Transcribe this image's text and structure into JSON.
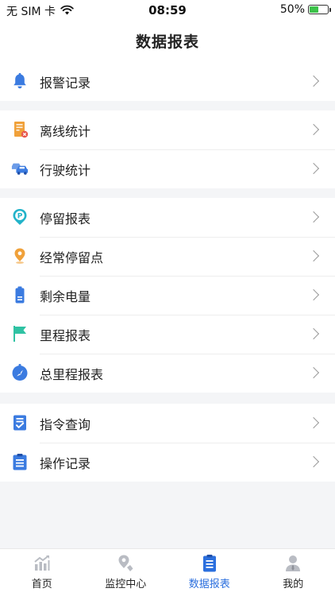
{
  "status_bar": {
    "carrier": "无 SIM 卡",
    "time": "08:59",
    "battery_percent": "50%",
    "battery_level": 0.5
  },
  "nav": {
    "title": "数据报表"
  },
  "groups": [
    {
      "items": [
        {
          "label": "报警记录",
          "icon": "bell-icon"
        }
      ]
    },
    {
      "items": [
        {
          "label": "离线统计",
          "icon": "offline-server-icon"
        },
        {
          "label": "行驶统计",
          "icon": "car-icon"
        }
      ]
    },
    {
      "items": [
        {
          "label": "停留报表",
          "icon": "parking-pin-icon"
        },
        {
          "label": "经常停留点",
          "icon": "location-pin-icon"
        },
        {
          "label": "剩余电量",
          "icon": "battery-icon"
        },
        {
          "label": "里程报表",
          "icon": "flag-icon"
        },
        {
          "label": "总里程报表",
          "icon": "compass-icon"
        }
      ]
    },
    {
      "items": [
        {
          "label": "指令查询",
          "icon": "checklist-icon"
        },
        {
          "label": "操作记录",
          "icon": "clipboard-list-icon"
        }
      ]
    }
  ],
  "tabs": [
    {
      "label": "首页",
      "icon": "chart-icon",
      "active": false
    },
    {
      "label": "监控中心",
      "icon": "map-pin-icon",
      "active": false
    },
    {
      "label": "数据报表",
      "icon": "report-icon",
      "active": true
    },
    {
      "label": "我的",
      "icon": "user-icon",
      "active": false
    }
  ],
  "colors": {
    "accent": "#2b6fde",
    "bell": "#3b7be0",
    "offline": "#f0a13a",
    "offline_badge": "#e8554a",
    "car": "#3b7be0",
    "parking": "#22b3c9",
    "pin": "#f0a13a",
    "battery": "#3b7be0",
    "flag": "#2fc2a3",
    "compass": "#3b7be0",
    "tab_inactive": "#b9bcc3"
  }
}
